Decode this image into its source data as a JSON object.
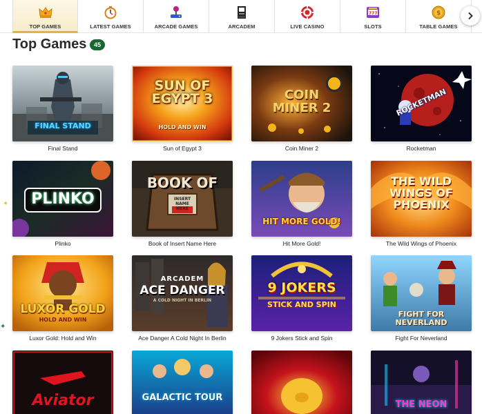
{
  "tabs": [
    {
      "label": "TOP GAMES",
      "icon": "crown-icon",
      "active": true
    },
    {
      "label": "LATEST GAMES",
      "icon": "stopwatch-icon",
      "active": false
    },
    {
      "label": "ARCADE GAMES",
      "icon": "joystick-icon",
      "active": false
    },
    {
      "label": "ARCADEM",
      "icon": "arcade-cabinet-icon",
      "active": false
    },
    {
      "label": "LIVE CASINO",
      "icon": "roulette-chip-icon",
      "active": false
    },
    {
      "label": "SLOTS",
      "icon": "slot-machine-icon",
      "active": false
    },
    {
      "label": "TABLE GAMES",
      "icon": "coin-icon",
      "active": false
    }
  ],
  "section": {
    "title": "Top Games",
    "count": "45"
  },
  "colors": {
    "accent_green": "#17682f",
    "active_tab_border": "#e0b640"
  },
  "games": [
    {
      "name": "Final Stand",
      "art": "FINAL STAND"
    },
    {
      "name": "Sun of Egypt 3",
      "art": "SUN OF EGYPT 3",
      "sub": "HOLD AND WIN"
    },
    {
      "name": "Coin Miner 2",
      "art": "COIN MINER 2"
    },
    {
      "name": "Rocketman",
      "art": "ROCKETMAN"
    },
    {
      "name": "Plinko",
      "art": "PLINKO"
    },
    {
      "name": "Book of Insert Name Here",
      "art": "BOOK OF",
      "sub": "INSERT NAME HERE"
    },
    {
      "name": "Hit More Gold!",
      "art": "HIT MORE GOLD!"
    },
    {
      "name": "The Wild Wings of Phoenix",
      "art": "THE WILD WINGS OF PHOENIX"
    },
    {
      "name": "Luxor Gold: Hold and Win",
      "art": "LUXOR GOLD",
      "sub": "HOLD AND WIN"
    },
    {
      "name": "Ace Danger A Cold Night In Berlin",
      "art": "ACE DANGER",
      "sub": "A COLD NIGHT IN BERLIN",
      "top": "ARCADEM"
    },
    {
      "name": "9 Jokers Stick and Spin",
      "art": "9 JOKERS",
      "sub": "STICK AND SPIN"
    },
    {
      "name": "Fight For Neverland",
      "art": "FIGHT FOR NEVERLAND"
    },
    {
      "name": "",
      "art": "Aviator"
    },
    {
      "name": "",
      "art": "GALACTIC TOUR"
    },
    {
      "name": "",
      "art": ""
    },
    {
      "name": "",
      "art": "THE NEON"
    }
  ]
}
